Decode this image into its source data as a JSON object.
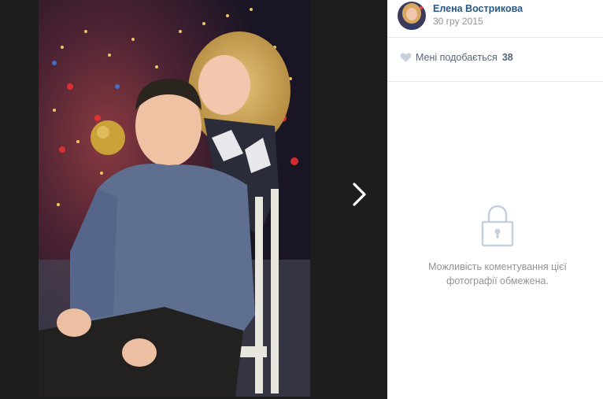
{
  "author": {
    "name": "Елена Вострикова",
    "date": "30 гру 2015",
    "avatar_icon": "user-avatar"
  },
  "likes": {
    "label": "Мені подобається",
    "count": "38",
    "icon": "heart-icon"
  },
  "comments": {
    "restricted_line1": "Можливість коментування цієї",
    "restricted_line2": "фотографії обмежена.",
    "icon": "lock-icon"
  },
  "viewer": {
    "next_icon": "chevron-right-icon"
  },
  "colors": {
    "viewer_bg": "#1d1d1d",
    "link": "#2a5885",
    "muted": "#939393",
    "like_text": "#55677d"
  }
}
